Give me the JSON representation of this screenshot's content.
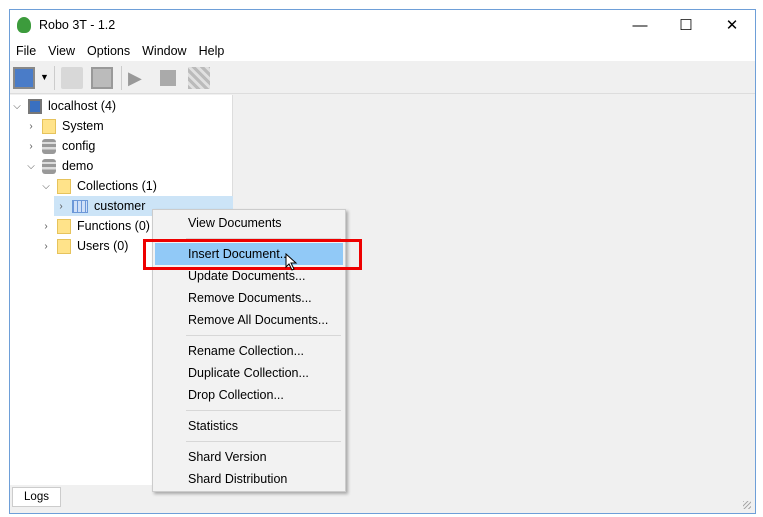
{
  "window": {
    "title": "Robo 3T - 1.2",
    "minimize": "—",
    "maximize": "☐",
    "close": "✕"
  },
  "menu": [
    "File",
    "View",
    "Options",
    "Window",
    "Help"
  ],
  "tree": {
    "root": "localhost (4)",
    "items": [
      "System",
      "config",
      "demo",
      "Collections (1)",
      "customer",
      "Functions (0)",
      "Users (0)"
    ]
  },
  "context_menu": {
    "items": [
      "View Documents",
      "Insert Document...",
      "Update Documents...",
      "Remove Documents...",
      "Remove All Documents...",
      "Rename Collection...",
      "Duplicate Collection...",
      "Drop Collection...",
      "Statistics",
      "Shard Version",
      "Shard Distribution"
    ],
    "highlighted": "Insert Document..."
  },
  "bottom_tab": "Logs",
  "colors": {
    "highlight": "#91c9f7",
    "annotation": "#ee0000"
  }
}
